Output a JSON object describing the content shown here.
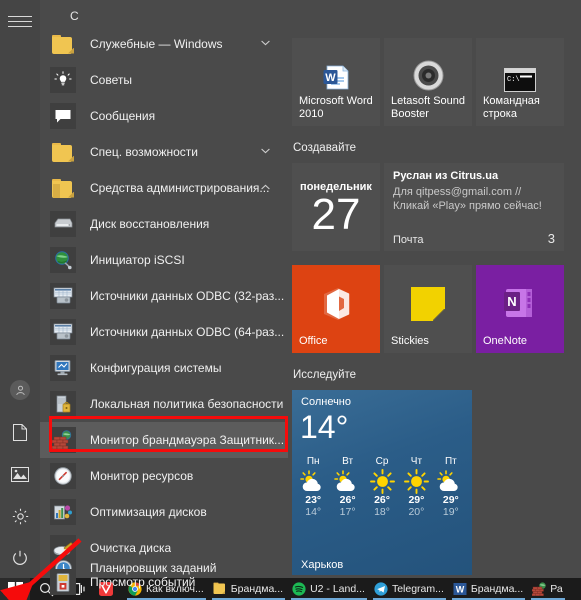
{
  "window": {
    "os": "Windows 10 Start Menu",
    "title": ""
  },
  "start_menu": {
    "rail": {
      "hamburger": "hamburger-menu",
      "items": [
        {
          "name": "user-account",
          "icon": "person-icon",
          "label": ""
        },
        {
          "name": "documents",
          "icon": "document-icon",
          "label": ""
        },
        {
          "name": "pictures",
          "icon": "picture-icon",
          "label": ""
        },
        {
          "name": "settings",
          "icon": "gear-icon",
          "label": ""
        },
        {
          "name": "power",
          "icon": "power-icon",
          "label": ""
        }
      ]
    },
    "app_list": {
      "group_letter": "C",
      "items": [
        {
          "label": "Служебные — Windows",
          "icon": "folder-icon",
          "type": "folder",
          "expander": "chevron-down",
          "selected": false
        },
        {
          "label": "Советы",
          "icon": "lightbulb-icon",
          "type": "app",
          "expander": "",
          "selected": false
        },
        {
          "label": "Сообщения",
          "icon": "chat-bubble-icon",
          "type": "app",
          "expander": "",
          "selected": false
        },
        {
          "label": "Спец. возможности",
          "icon": "folder-icon",
          "type": "folder",
          "expander": "chevron-down",
          "selected": false
        },
        {
          "label": "Средства администрирования...",
          "icon": "folder-open-icon",
          "type": "folder",
          "expander": "chevron-up",
          "selected": false
        },
        {
          "label": "Диск восстановления",
          "icon": "recovery-drive-icon",
          "type": "app",
          "expander": "",
          "selected": false
        },
        {
          "label": "Инициатор iSCSI",
          "icon": "iscsi-globe-icon",
          "type": "app",
          "expander": "",
          "selected": false
        },
        {
          "label": "Источники данных ODBC (32-раз...",
          "icon": "odbc-icon",
          "type": "app",
          "expander": "",
          "selected": false
        },
        {
          "label": "Источники данных ODBC (64-раз...",
          "icon": "odbc-icon",
          "type": "app",
          "expander": "",
          "selected": false
        },
        {
          "label": "Конфигурация системы",
          "icon": "system-config-icon",
          "type": "app",
          "expander": "",
          "selected": false
        },
        {
          "label": "Локальная политика безопасности",
          "icon": "security-policy-icon",
          "type": "app",
          "expander": "",
          "selected": false
        },
        {
          "label": "Монитор брандмауэра Защитник...",
          "icon": "firewall-brick-icon",
          "type": "app",
          "expander": "",
          "selected": true
        },
        {
          "label": "Монитор ресурсов",
          "icon": "resource-monitor-icon",
          "type": "app",
          "expander": "",
          "selected": false
        },
        {
          "label": "Оптимизация дисков",
          "icon": "defrag-icon",
          "type": "app",
          "expander": "",
          "selected": false
        },
        {
          "label": "Очистка диска",
          "icon": "disk-cleanup-icon",
          "type": "app",
          "expander": "",
          "selected": false
        },
        {
          "label": "Планировщик заданий",
          "icon": "task-scheduler-clock-icon",
          "type": "app",
          "expander": "",
          "selected": false
        },
        {
          "label": "Просмотр событий",
          "icon": "event-viewer-icon",
          "type": "app",
          "expander": "",
          "selected": false
        }
      ]
    },
    "tiles": {
      "groups": [
        {
          "heading": "",
          "heading_visible": false
        },
        {
          "heading": "Создавайте",
          "heading_visible": true
        },
        {
          "heading": "Исследуйте",
          "heading_visible": true
        }
      ],
      "row1": [
        {
          "label": "Microsoft Word 2010",
          "icon": "word-icon",
          "bg": "#4f4f4f"
        },
        {
          "label": "Letasoft Sound Booster",
          "icon": "speaker-icon",
          "bg": "#4f4f4f"
        },
        {
          "label": "Командная строка",
          "icon": "command-prompt-icon",
          "bg": "#4f4f4f"
        }
      ],
      "date_tile": {
        "weekday": "понедельник",
        "day": "27",
        "bg": "#4f4f4f"
      },
      "mail_tile": {
        "from": "Руслан из Citrus.ua",
        "preview": "Для qitpess@gmail.com // Кликай «Play» прямо сейчас!",
        "app": "Почта",
        "unread": "3",
        "bg": "#4f4f4f"
      },
      "row3": [
        {
          "label": "Office",
          "icon": "office-icon",
          "bg": "#dd4312"
        },
        {
          "label": "Stickies",
          "icon": "sticky-note-icon",
          "bg": "#4f4f4f"
        },
        {
          "label": "OneNote",
          "icon": "onenote-icon",
          "bg": "#7a1fa2"
        }
      ],
      "weather_tile": {
        "condition": "Солнечно",
        "temperature": "14°",
        "city": "Харьков",
        "forecast": [
          {
            "dow": "Пн",
            "icon": "sun-behind-cloud-icon",
            "hi": "23°",
            "lo": "14°"
          },
          {
            "dow": "Вт",
            "icon": "sun-behind-cloud-icon",
            "hi": "26°",
            "lo": "17°"
          },
          {
            "dow": "Ср",
            "icon": "sun-icon",
            "hi": "26°",
            "lo": "18°"
          },
          {
            "dow": "Чт",
            "icon": "sun-icon",
            "hi": "29°",
            "lo": "20°"
          },
          {
            "dow": "Пт",
            "icon": "sun-behind-cloud-icon",
            "hi": "29°",
            "lo": "19°"
          }
        ]
      }
    }
  },
  "taskbar": {
    "start": {
      "icon": "windows-logo-icon",
      "label": ""
    },
    "search": {
      "icon": "search-icon",
      "label": ""
    },
    "task_view": {
      "icon": "task-view-icon",
      "label": ""
    },
    "apps": [
      {
        "label": "",
        "icon": "vivaldi-icon",
        "running": false
      },
      {
        "label": "Как включ...",
        "icon": "chrome-icon",
        "running": true
      },
      {
        "label": "Брандма...",
        "icon": "folder-icon",
        "running": true
      },
      {
        "label": "U2 - Land...",
        "icon": "spotify-icon",
        "running": true
      },
      {
        "label": "Telegram...",
        "icon": "telegram-icon",
        "running": true
      },
      {
        "label": "Брандма...",
        "icon": "word-icon",
        "running": true
      },
      {
        "label": "Ра",
        "icon": "firewall-brick-icon",
        "running": true
      }
    ]
  },
  "annotations": {
    "highlight_rect": {
      "target": "Монитор брандмауэра Защитник...",
      "color": "#f60b0b"
    },
    "arrow": {
      "target": "start-button",
      "color": "#f60b0b"
    }
  },
  "colors": {
    "menu_bg": "#4a4a4a",
    "rail_bg": "#454545",
    "tile_bg": "#4f4f4f",
    "taskbar_bg": "#1b1b1b",
    "accent": "#f60b0b",
    "selection": "#5c5c5c"
  }
}
